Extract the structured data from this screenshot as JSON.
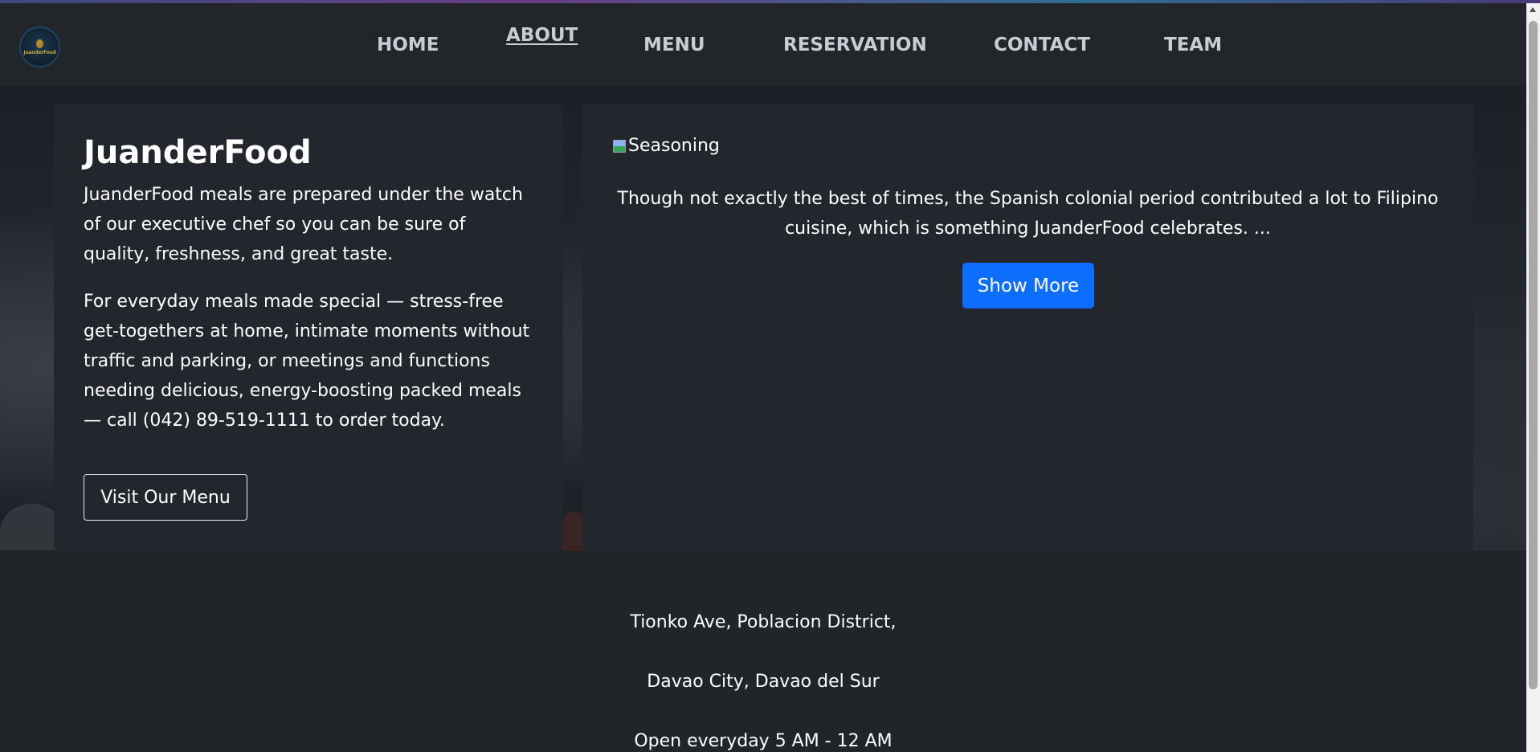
{
  "nav": {
    "logo_text": "JuanderFood",
    "links": [
      {
        "label": "HOME"
      },
      {
        "label": "ABOUT",
        "active": true
      },
      {
        "label": "MENU"
      },
      {
        "label": "RESERVATION"
      },
      {
        "label": "CONTACT"
      },
      {
        "label": "TEAM"
      }
    ]
  },
  "about_card": {
    "title": "JuanderFood",
    "paragraph_1": "JuanderFood meals are prepared under the watch of our executive chef so you can be sure of quality, freshness, and great taste.",
    "paragraph_2": "For everyday meals made special — stress-free get-togethers at home, intimate moments without traffic and parking, or meetings and functions needing delicious, energy-boosting packed meals — call (042) 89-519-1111 to order today.",
    "button_label": "Visit Our Menu"
  },
  "feature_card": {
    "image_alt": "Seasoning",
    "text": "Though not exactly the best of times, the Spanish colonial period contributed a lot to Filipino cuisine, which is something JuanderFood celebrates. ...",
    "button_label": "Show More"
  },
  "footer": {
    "address_line_1": "Tionko Ave, Poblacion District,",
    "address_line_2": "Davao City, Davao del Sur",
    "hours": "Open everyday 5 AM - 12 AM"
  },
  "colors": {
    "background": "#212529",
    "card": "#23272d",
    "primary_button": "#0d6efd",
    "nav_link": "#c9cdd2"
  }
}
